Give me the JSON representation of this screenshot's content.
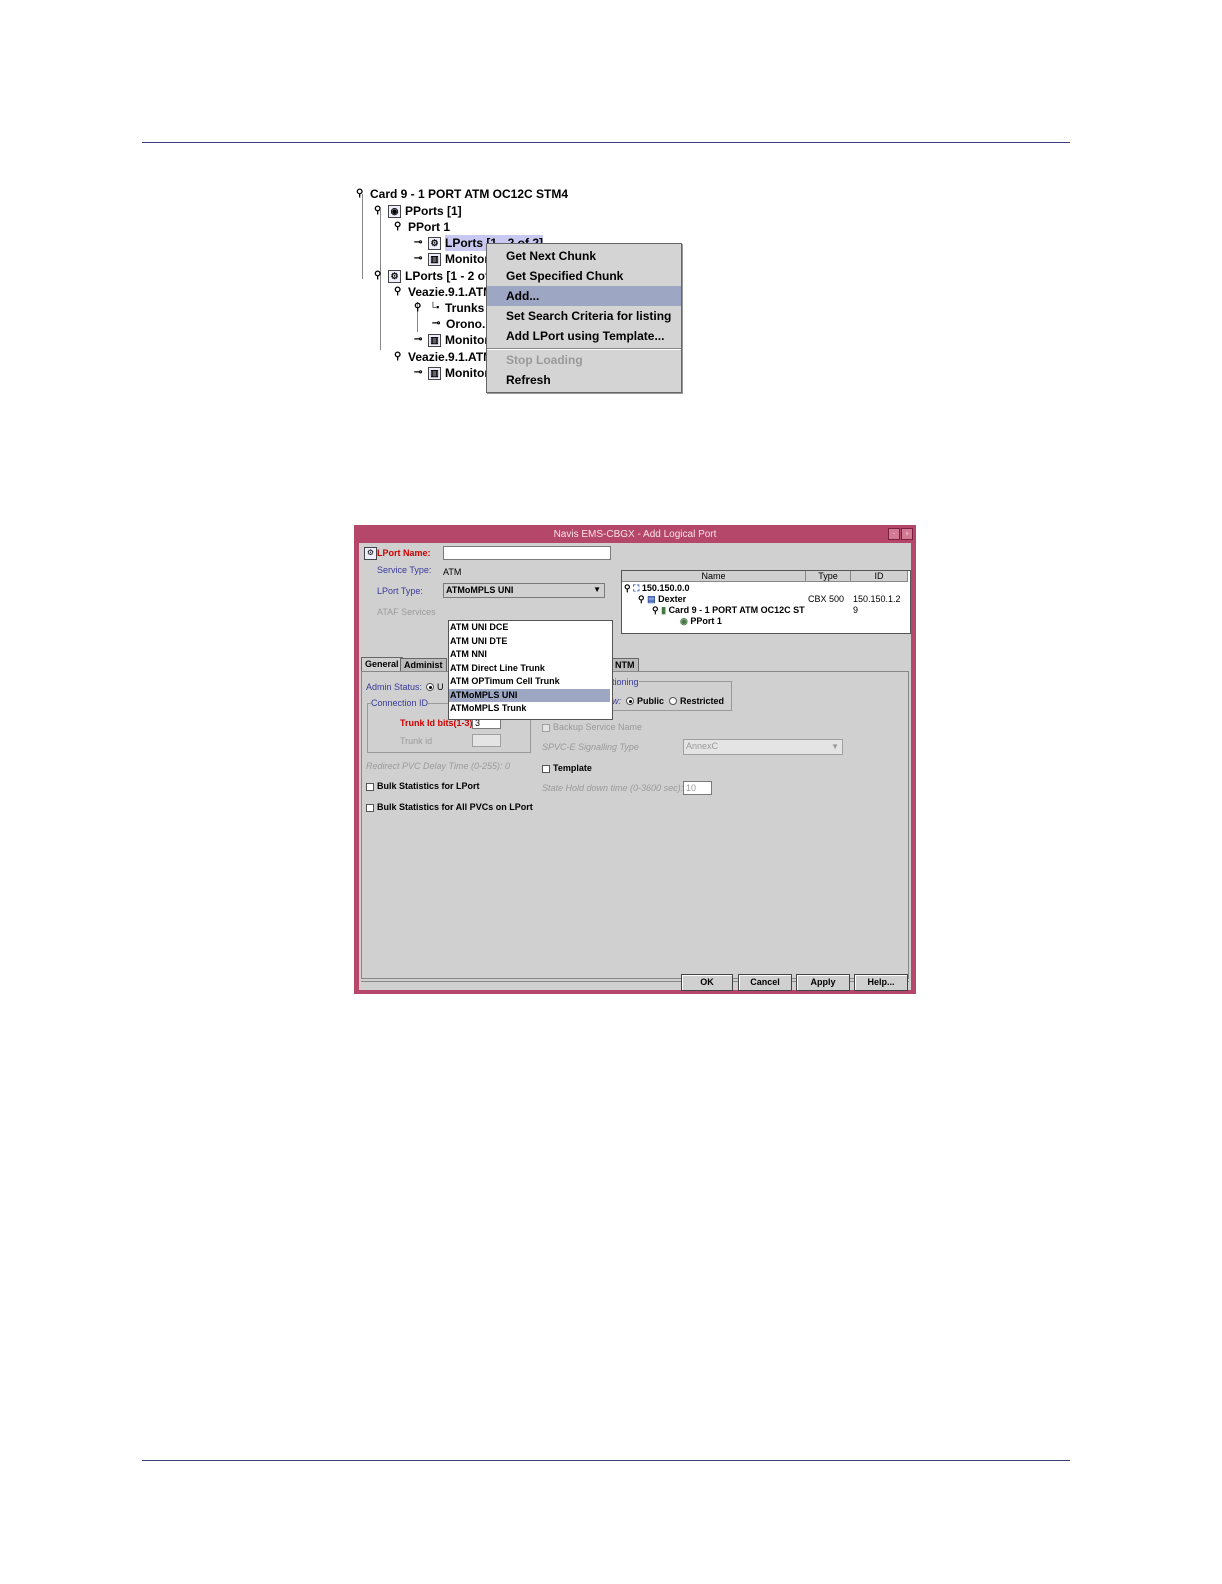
{
  "tree": {
    "nodes": [
      {
        "label": "Card 9 - 1 PORT ATM OC12C STM4",
        "icon": "expanded-toggle-icon"
      },
      {
        "label": "PPorts [1]",
        "icon": "pports-folder-icon"
      },
      {
        "label": "PPort 1",
        "icon": "pport-icon"
      },
      {
        "label": "LPorts [1 - 2 of 2]",
        "icon": "lports-folder-icon"
      },
      {
        "label": "Monitor",
        "icon": "monitor-chart-icon"
      },
      {
        "label": "LPorts [1 - 2 of",
        "icon": "lports-folder-icon"
      },
      {
        "label": "Veazie.9.1.ATM",
        "icon": "lport-icon"
      },
      {
        "label": "Trunks",
        "icon": "trunks-icon"
      },
      {
        "label": "Orono.",
        "icon": "trunk-node-icon"
      },
      {
        "label": "Monitor",
        "icon": "monitor-chart-icon"
      },
      {
        "label": "Veazie.9.1.ATM",
        "icon": "lport-icon"
      },
      {
        "label": "Monitor",
        "icon": "monitor-chart-icon"
      }
    ]
  },
  "context_menu": {
    "items": [
      {
        "label": "Get Next Chunk"
      },
      {
        "label": "Get Specified Chunk"
      },
      {
        "label": "Add..."
      },
      {
        "label": "Set Search Criteria for listing"
      },
      {
        "label": "Add LPort using Template..."
      },
      {
        "label": "Stop Loading"
      },
      {
        "label": "Refresh"
      }
    ],
    "selected": "Add...",
    "disabled": "Stop Loading"
  },
  "dialog": {
    "title": "Navis EMS-CBGX - Add Logical Port",
    "lport_name_label": "LPort Name:",
    "lport_name_value": "",
    "service_type_label": "Service Type:",
    "service_type_value": "ATM",
    "lport_type_label": "LPort Type:",
    "lport_type_value": "ATMoMPLS UNI",
    "ataf_services_label": "ATAF Services",
    "table": {
      "headers": [
        "Name",
        "Type",
        "ID"
      ],
      "rows": [
        {
          "name": "150.150.0.0",
          "type": "",
          "id": ""
        },
        {
          "name": "Dexter",
          "type": "CBX 500",
          "id": "150.150.1.2"
        },
        {
          "name": "Card 9 - 1 PORT ATM OC12C ST",
          "type": "",
          "id": "9"
        },
        {
          "name": "PPort 1",
          "type": "",
          "id": ""
        }
      ]
    },
    "tabs": [
      "General",
      "Administ",
      "M",
      "NTM"
    ],
    "dropdown_options": [
      "ATM UNI DCE",
      "ATM UNI DTE",
      "ATM NNI",
      "ATM Direct Line Trunk",
      "ATM OPTimum Cell Trunk",
      "ATMoMPLS UNI",
      "ATMoMPLS Trunk"
    ],
    "general": {
      "admin_status_label": "Admin Status:",
      "admin_status_value": "U",
      "connection_id_label": "Connection ID",
      "trunk_id_bits_label": "Trunk Id bits(1-3)",
      "trunk_id_bits_value": "3",
      "trunk_id_label": "Trunk id",
      "redirect_pvc_label": "Redirect PVC Delay Time (0-255): 0",
      "bulk_stats_lport": "Bulk Statistics for LPort",
      "bulk_stats_pvcs": "Bulk Statistics for All PVCs on LPort",
      "partitioning_label": "itioning",
      "allow_label": "low:",
      "public_label": "Public",
      "restricted_label": "Restricted",
      "backup_service_label": "Backup Service Name",
      "spvc_label": "SPVC-E Signalling Type",
      "spvc_value": "AnnexC",
      "template_label": "Template",
      "state_hold_label": "State Hold down time (0-3600 sec):",
      "state_hold_value": "10"
    },
    "buttons": {
      "ok": "OK",
      "cancel": "Cancel",
      "apply": "Apply",
      "help": "Help..."
    }
  }
}
